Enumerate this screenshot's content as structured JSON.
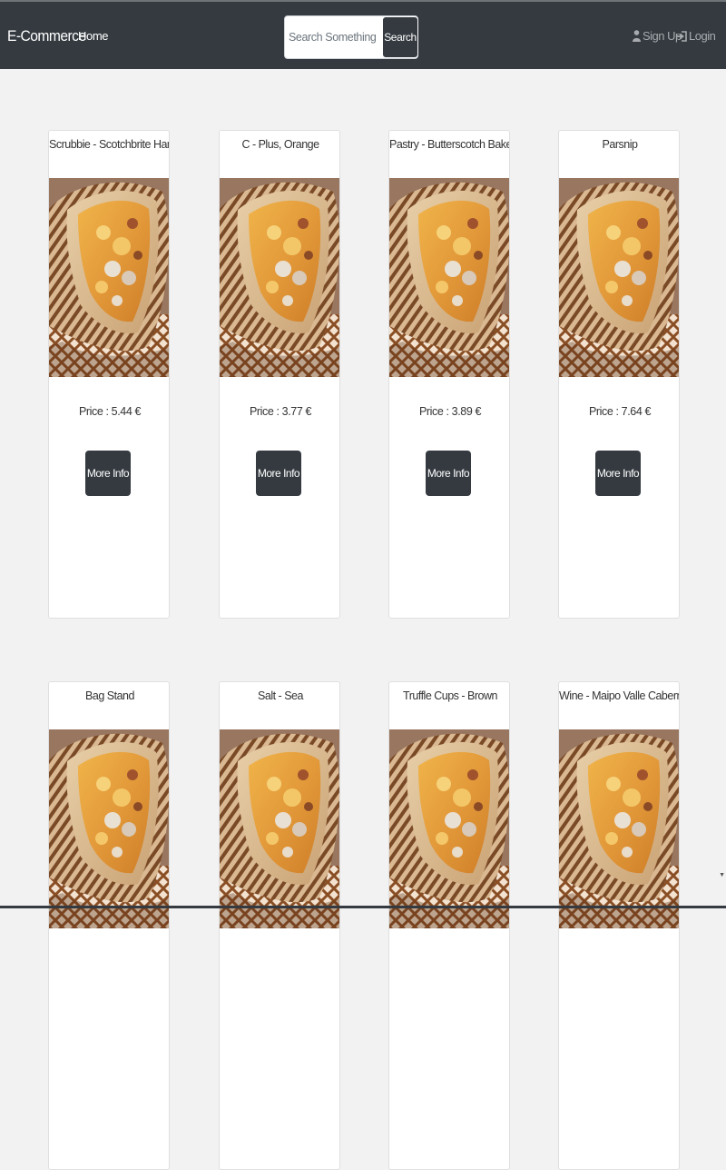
{
  "navbar": {
    "brand": "E-Commerce",
    "home_label": "Home",
    "search": {
      "placeholder": "Search Something",
      "value": "",
      "button_label": "Search"
    },
    "signup_label": "Sign Up",
    "login_label": "Login"
  },
  "products": [
    {
      "name": "Scrubbie - Scotchbrite Hand Pad",
      "price": "Price : 5.44 €",
      "button_label": "More Info",
      "image_icon": "burrito-photo"
    },
    {
      "name": "C - Plus, Orange",
      "price": "Price : 3.77 €",
      "button_label": "More Info",
      "image_icon": "burrito-photo"
    },
    {
      "name": "Pastry - Butterscotch Baked",
      "price": "Price : 3.89 €",
      "button_label": "More Info",
      "image_icon": "burrito-photo"
    },
    {
      "name": "Parsnip",
      "price": "Price : 7.64 €",
      "button_label": "More Info",
      "image_icon": "burrito-photo"
    },
    {
      "name": "Bag Stand",
      "price": "",
      "button_label": "",
      "image_icon": "burrito-photo"
    },
    {
      "name": "Salt - Sea",
      "price": "",
      "button_label": "",
      "image_icon": "burrito-photo"
    },
    {
      "name": "Truffle Cups - Brown",
      "price": "",
      "button_label": "",
      "image_icon": "burrito-photo"
    },
    {
      "name": "Wine - Maipo Valle Cabernet",
      "price": "",
      "button_label": "",
      "image_icon": "burrito-photo"
    }
  ],
  "colors": {
    "navbar_bg": "#343a40",
    "page_bg": "#f2f2f2",
    "card_bg": "#ffffff",
    "button_bg": "#343a40",
    "nav_muted_text": "#a7abaf"
  }
}
